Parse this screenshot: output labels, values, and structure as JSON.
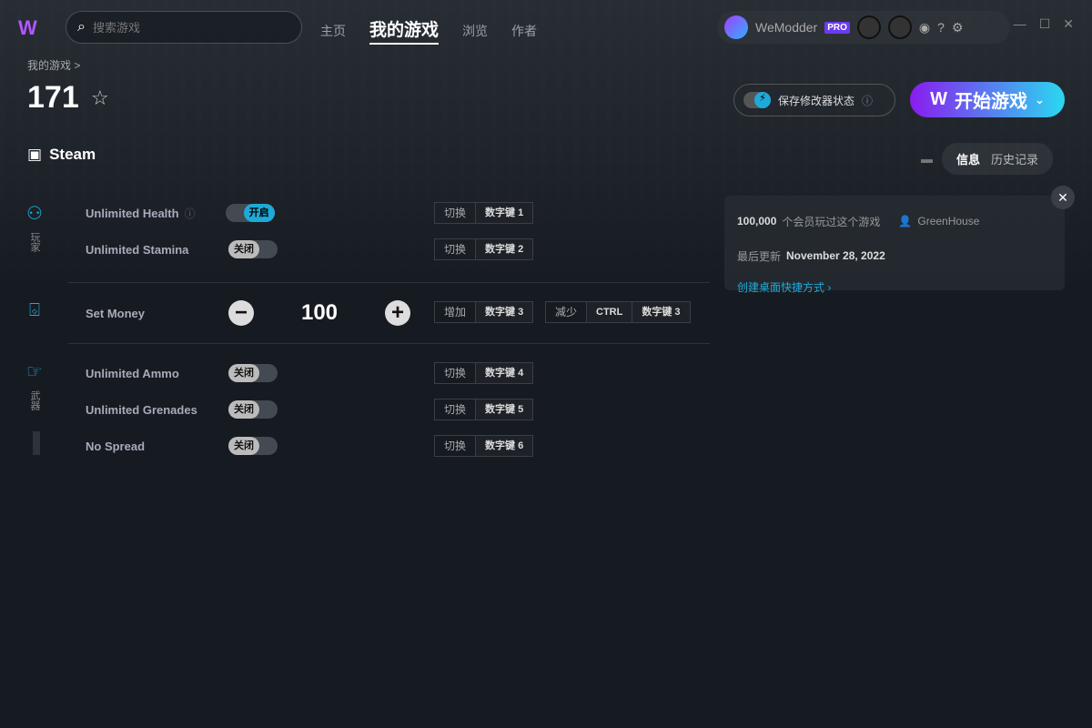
{
  "header": {
    "search_placeholder": "搜索游戏",
    "nav": [
      "主页",
      "我的游戏",
      "浏览",
      "作者"
    ],
    "username": "WeModder",
    "badge": "PRO"
  },
  "breadcrumb": "我的游戏 >",
  "game": {
    "title": "171",
    "platform": "Steam"
  },
  "save_state": "保存修改器状态",
  "play": "开始游戏",
  "tabs": {
    "info": "信息",
    "history": "历史记录"
  },
  "info": {
    "members": "100,000",
    "members_text": "个会员玩过这个游戏",
    "author": "GreenHouse",
    "updated_label": "最后更新",
    "updated": "November 28, 2022",
    "shortcut": "创建桌面快捷方式 ›"
  },
  "categories": {
    "player": "玩家",
    "weapons": "武器"
  },
  "cheats": [
    {
      "name": "Unlimited Health",
      "state": "开启",
      "action": "切换",
      "key": "数字键 1"
    },
    {
      "name": "Unlimited Stamina",
      "state": "关闭",
      "action": "切换",
      "key": "数字键 2"
    },
    {
      "name": "Set Money",
      "value": "100",
      "inc": "增加",
      "inc_key": "数字键 3",
      "dec": "减少",
      "dec_mod": "CTRL",
      "dec_key": "数字键 3"
    },
    {
      "name": "Unlimited Ammo",
      "state": "关闭",
      "action": "切换",
      "key": "数字键 4"
    },
    {
      "name": "Unlimited Grenades",
      "state": "关闭",
      "action": "切换",
      "key": "数字键 5"
    },
    {
      "name": "No Spread",
      "state": "关闭",
      "action": "切换",
      "key": "数字键 6"
    }
  ],
  "colors": {
    "accent": "#1eaad8",
    "play_start": "#8a1cf0",
    "play_end": "#2ad8f0"
  }
}
